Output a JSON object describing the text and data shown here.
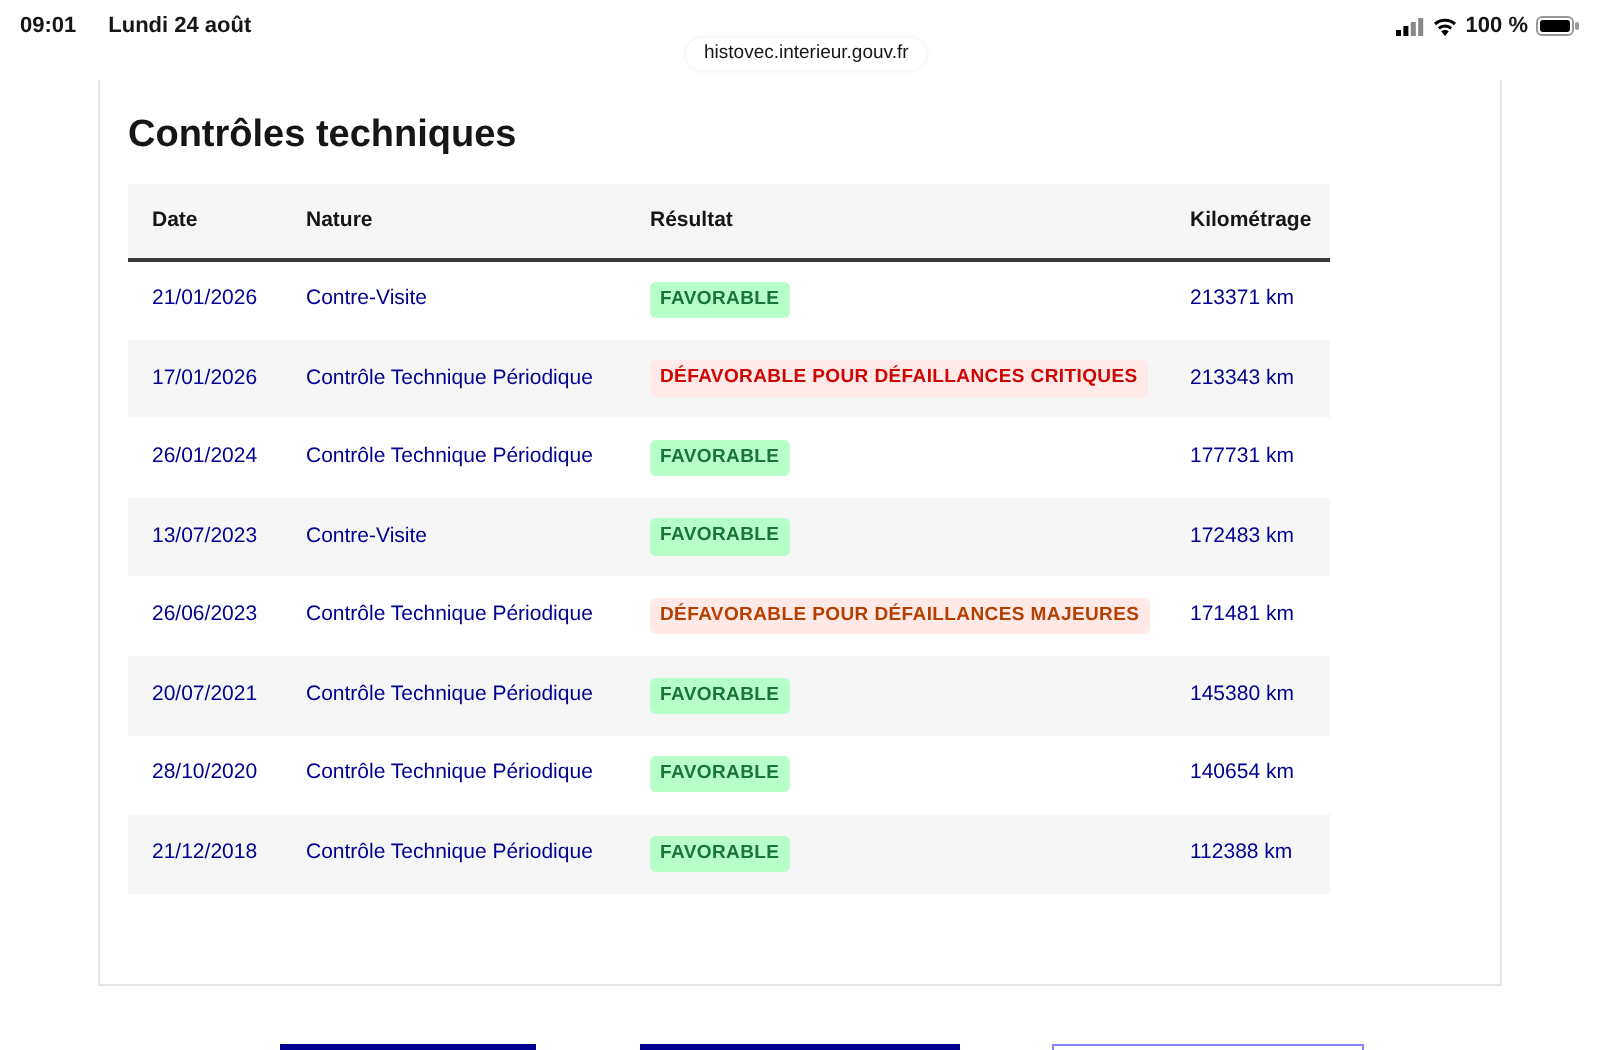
{
  "status_bar": {
    "time": "09:01",
    "date": "Lundi 24 août",
    "url": "histovec.interieur.gouv.fr",
    "battery": "100 %"
  },
  "section": {
    "title": "Contrôles techniques"
  },
  "table": {
    "columns": [
      "Date",
      "Nature",
      "Résultat",
      "Kilométrage"
    ],
    "rows": [
      {
        "date": "21/01/2026",
        "nature": "Contre-Visite",
        "result": "FAVORABLE",
        "kind": "favorable",
        "mileage": "213371 km"
      },
      {
        "date": "17/01/2026",
        "nature": "Contrôle Technique Périodique",
        "result": "DÉFAVORABLE POUR DÉFAILLANCES CRITIQUES",
        "kind": "critical",
        "mileage": "213343 km"
      },
      {
        "date": "26/01/2024",
        "nature": "Contrôle Technique Périodique",
        "result": "FAVORABLE",
        "kind": "favorable",
        "mileage": "177731 km"
      },
      {
        "date": "13/07/2023",
        "nature": "Contre-Visite",
        "result": "FAVORABLE",
        "kind": "favorable",
        "mileage": "172483 km"
      },
      {
        "date": "26/06/2023",
        "nature": "Contrôle Technique Périodique",
        "result": "DÉFAVORABLE POUR DÉFAILLANCES MAJEURES",
        "kind": "major",
        "mileage": "171481 km"
      },
      {
        "date": "20/07/2021",
        "nature": "Contrôle Technique Périodique",
        "result": "FAVORABLE",
        "kind": "favorable",
        "mileage": "145380 km"
      },
      {
        "date": "28/10/2020",
        "nature": "Contrôle Technique Périodique",
        "result": "FAVORABLE",
        "kind": "favorable",
        "mileage": "140654 km"
      },
      {
        "date": "21/12/2018",
        "nature": "Contrôle Technique Périodique",
        "result": "FAVORABLE",
        "kind": "favorable",
        "mileage": "112388 km"
      }
    ]
  },
  "bottom_buttons": [
    {
      "kind": "filled"
    },
    {
      "kind": "filled"
    },
    {
      "kind": "outline"
    }
  ]
}
